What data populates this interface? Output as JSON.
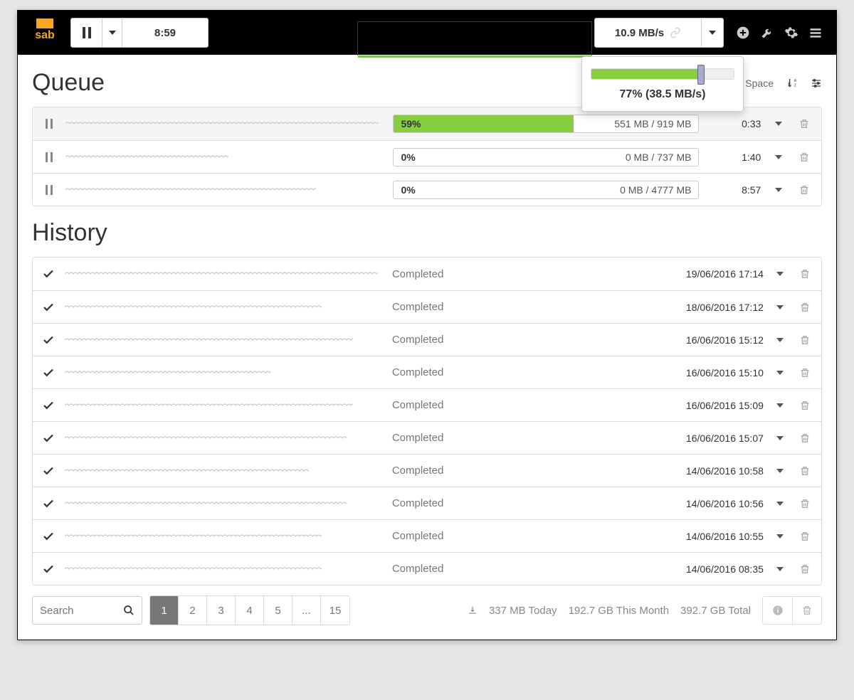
{
  "topbar": {
    "time_left": "8:59",
    "speed": "10.9 MB/s"
  },
  "speed_popover": {
    "percent": 77,
    "label": "77% (38.5 MB/s)"
  },
  "queue": {
    "title": "Queue",
    "free_space_label": "Free Space",
    "items": [
      {
        "percent_label": "59%",
        "percent": 59,
        "size": "551 MB / 919 MB",
        "eta": "0:33"
      },
      {
        "percent_label": "0%",
        "percent": 0,
        "size": "0 MB / 737 MB",
        "eta": "1:40"
      },
      {
        "percent_label": "0%",
        "percent": 0,
        "size": "0 MB / 4777 MB",
        "eta": "8:57"
      }
    ]
  },
  "history": {
    "title": "History",
    "status_label": "Completed",
    "items": [
      {
        "date": "19/06/2016 17:14"
      },
      {
        "date": "18/06/2016 17:12"
      },
      {
        "date": "16/06/2016 15:12"
      },
      {
        "date": "16/06/2016 15:10"
      },
      {
        "date": "16/06/2016 15:09"
      },
      {
        "date": "16/06/2016 15:07"
      },
      {
        "date": "14/06/2016 10:58"
      },
      {
        "date": "14/06/2016 10:56"
      },
      {
        "date": "14/06/2016 10:55"
      },
      {
        "date": "14/06/2016 08:35"
      }
    ]
  },
  "footer": {
    "search_placeholder": "Search",
    "pages": [
      "1",
      "2",
      "3",
      "4",
      "5",
      "...",
      "15"
    ],
    "active_page": "1",
    "today": "337 MB Today",
    "month": "192.7 GB This Month",
    "total": "392.7 GB Total"
  }
}
